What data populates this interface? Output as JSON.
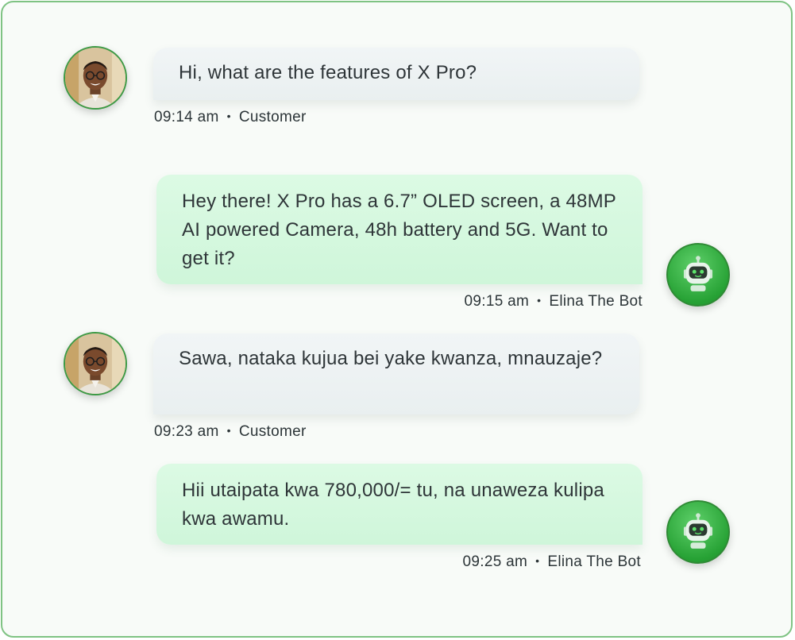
{
  "messages": [
    {
      "sender": "customer",
      "text": "Hi, what are the features of X Pro?",
      "time": "09:14 am",
      "author": "Customer"
    },
    {
      "sender": "bot",
      "text": "Hey there! X Pro has a 6.7” OLED screen, a 48MP AI powered Camera, 48h battery and 5G. Want to get it?",
      "time": "09:15 am",
      "author": "Elina The Bot"
    },
    {
      "sender": "customer",
      "text": "Sawa, nataka kujua bei yake kwanza, mnauzaje?",
      "time": "09:23 am",
      "author": "Customer"
    },
    {
      "sender": "bot",
      "text": "Hii utaipata kwa 780,000/= tu, na unaweza kulipa kwa awamu.",
      "time": "09:25 am",
      "author": "Elina The Bot"
    }
  ],
  "separator": "•",
  "icons": {
    "customer_avatar": "customer-avatar-icon",
    "bot_avatar": "robot-icon"
  },
  "colors": {
    "frame_border": "#7fc383",
    "bot_bubble": "#d5f8df",
    "customer_bubble": "#edf2f3",
    "bot_avatar": "#2fa63c"
  }
}
